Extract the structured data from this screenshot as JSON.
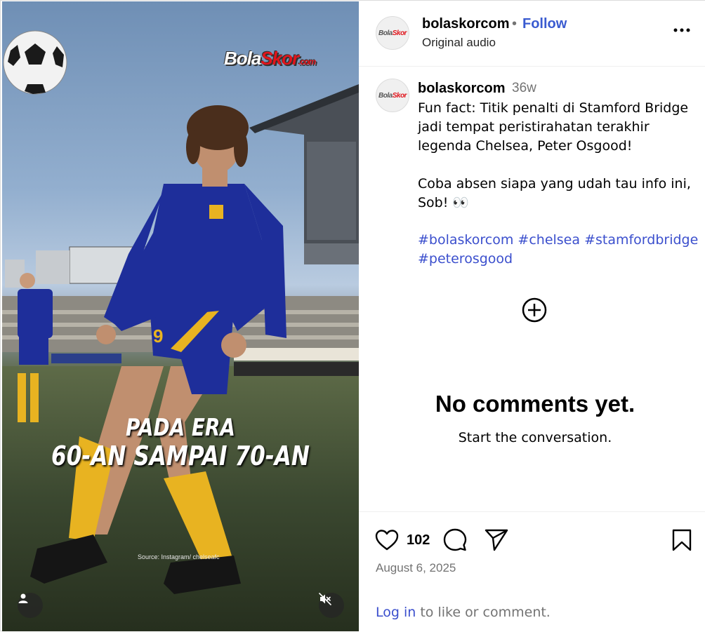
{
  "media": {
    "watermark_main": "Bola",
    "watermark_red": "Skor",
    "watermark_com": ".com",
    "caption_line1": "PADA ERA",
    "caption_line2": "60-AN SAMPAI 70-AN",
    "source": "Source: Instagram/ chelseafc",
    "player_number": "9",
    "user_icon": "person-icon",
    "mute_icon": "speaker-muted-icon"
  },
  "header": {
    "username": "bolaskorcom",
    "separator": "•",
    "follow_label": "Follow",
    "subtitle": "Original audio",
    "more_icon": "more-horizontal-icon"
  },
  "caption": {
    "username": "bolaskorcom",
    "time": "36w",
    "text": "Fun fact: Titik penalti di Stamford Bridge jadi tempat peristirahatan terakhir legenda Chelsea, Peter Osgood!\n\nCoba absen siapa yang udah tau info ini, Sob! 👀",
    "hashtags": [
      "#bolaskorcom",
      "#chelsea",
      "#stamfordbridge",
      "#peterosgood"
    ]
  },
  "comments": {
    "add_icon": "plus-circle-icon",
    "empty_title": "No comments yet.",
    "empty_subtitle": "Start the conversation."
  },
  "actions": {
    "like_icon": "heart-icon",
    "like_count": "102",
    "comment_icon": "comment-icon",
    "share_icon": "paper-plane-icon",
    "save_icon": "bookmark-icon",
    "date": "August 6, 2025",
    "login_link": "Log in",
    "login_rest": " to like or comment."
  },
  "colors": {
    "link": "#3b4fcd",
    "muted": "#737373",
    "brand_red": "#e0141b",
    "kit_blue": "#1e2e9a",
    "kit_yellow": "#e8b321"
  }
}
